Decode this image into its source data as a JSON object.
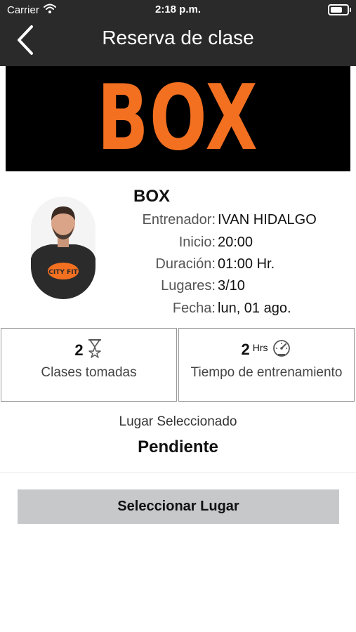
{
  "status_bar": {
    "carrier": "Carrier",
    "time": "2:18 p.m.",
    "battery_level": 0.9
  },
  "nav": {
    "title": "Reserva de clase",
    "back_icon": "chevron-left-icon"
  },
  "banner": {
    "text": "BOX",
    "text_color": "#f37021",
    "background": "#000000"
  },
  "class_info": {
    "name": "BOX",
    "details": [
      {
        "label": "Entrenador:",
        "value": "IVAN HIDALGO"
      },
      {
        "label": "Inicio:",
        "value": "20:00"
      },
      {
        "label": "Duración:",
        "value": "01:00 Hr."
      },
      {
        "label": "Lugares:",
        "value": "3/10"
      },
      {
        "label": "Fecha:",
        "value": "lun, 01 ago."
      }
    ],
    "trainer_shirt_logo": "CITY FIT"
  },
  "stats": [
    {
      "number": "2",
      "unit": "",
      "icon": "hourglass-star-icon",
      "label": "Clases tomadas"
    },
    {
      "number": "2",
      "unit": "Hrs",
      "icon": "speedometer-icon",
      "label": "Tiempo de entrenamiento"
    }
  ],
  "place": {
    "label": "Lugar Seleccionado",
    "value": "Pendiente"
  },
  "actions": {
    "select_place": "Seleccionar Lugar"
  },
  "colors": {
    "header_background": "#2a2a2a",
    "accent_orange": "#f37021",
    "button_background": "#c7c8ca"
  }
}
